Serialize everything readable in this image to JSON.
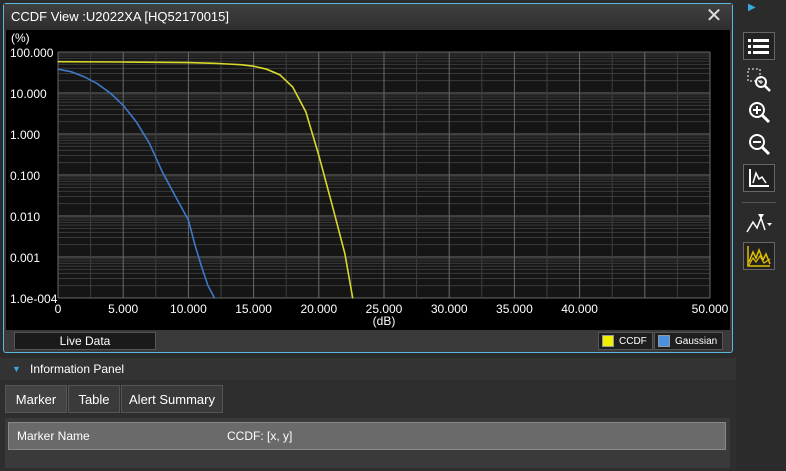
{
  "window": {
    "title": "CCDF View :U2022XA [HQ52170015]",
    "close_glyph": "✕"
  },
  "chart_data": {
    "type": "line",
    "ylabel": "(%)",
    "xlabel": "(dB)",
    "y_scale": "log",
    "y_ticks": [
      "100.000",
      "10.000",
      "1.000",
      "0.100",
      "0.010",
      "0.001",
      "1.0e-004"
    ],
    "x_ticks": [
      "0",
      "5.000",
      "10.000",
      "15.000",
      "20.000",
      "25.000",
      "30.000",
      "35.000",
      "40.000",
      "50.000"
    ],
    "xlim": [
      0,
      50
    ],
    "ylim": [
      0.0001,
      100
    ],
    "grid": true,
    "series": [
      {
        "name": "CCDF",
        "color": "#d8d82a",
        "x": [
          0,
          5,
          10,
          12,
          13,
          14,
          15,
          16,
          17,
          18,
          19,
          20,
          21,
          22,
          22.6
        ],
        "y": [
          58,
          57,
          55,
          53,
          51,
          49,
          45,
          38,
          28,
          14,
          3.5,
          0.3,
          0.02,
          0.0012,
          0.0001
        ]
      },
      {
        "name": "Gaussian",
        "color": "#3f78c8",
        "x": [
          0,
          1,
          2,
          3,
          4,
          5,
          6,
          7,
          8,
          9,
          10,
          10.5,
          11,
          11.5,
          12
        ],
        "y": [
          38,
          33,
          25,
          17,
          10,
          5,
          2,
          0.6,
          0.12,
          0.03,
          0.008,
          0.002,
          0.0006,
          0.0002,
          0.0001
        ]
      }
    ]
  },
  "status": {
    "live_data_label": "Live Data"
  },
  "legend": [
    {
      "label": "CCDF",
      "color": "#f0f000"
    },
    {
      "label": "Gaussian",
      "color": "#4a8fe0"
    }
  ],
  "toolbar": {
    "items": [
      "list-icon",
      "zoom-region-icon",
      "zoom-in-icon",
      "zoom-out-icon",
      "autoscale-icon",
      "marker-peak-icon",
      "trace-icon"
    ]
  },
  "info_panel": {
    "title": "Information Panel",
    "tabs": [
      "Marker",
      "Table",
      "Alert Summary"
    ],
    "table_headers": [
      "Marker Name",
      "CCDF: [x, y]"
    ]
  }
}
